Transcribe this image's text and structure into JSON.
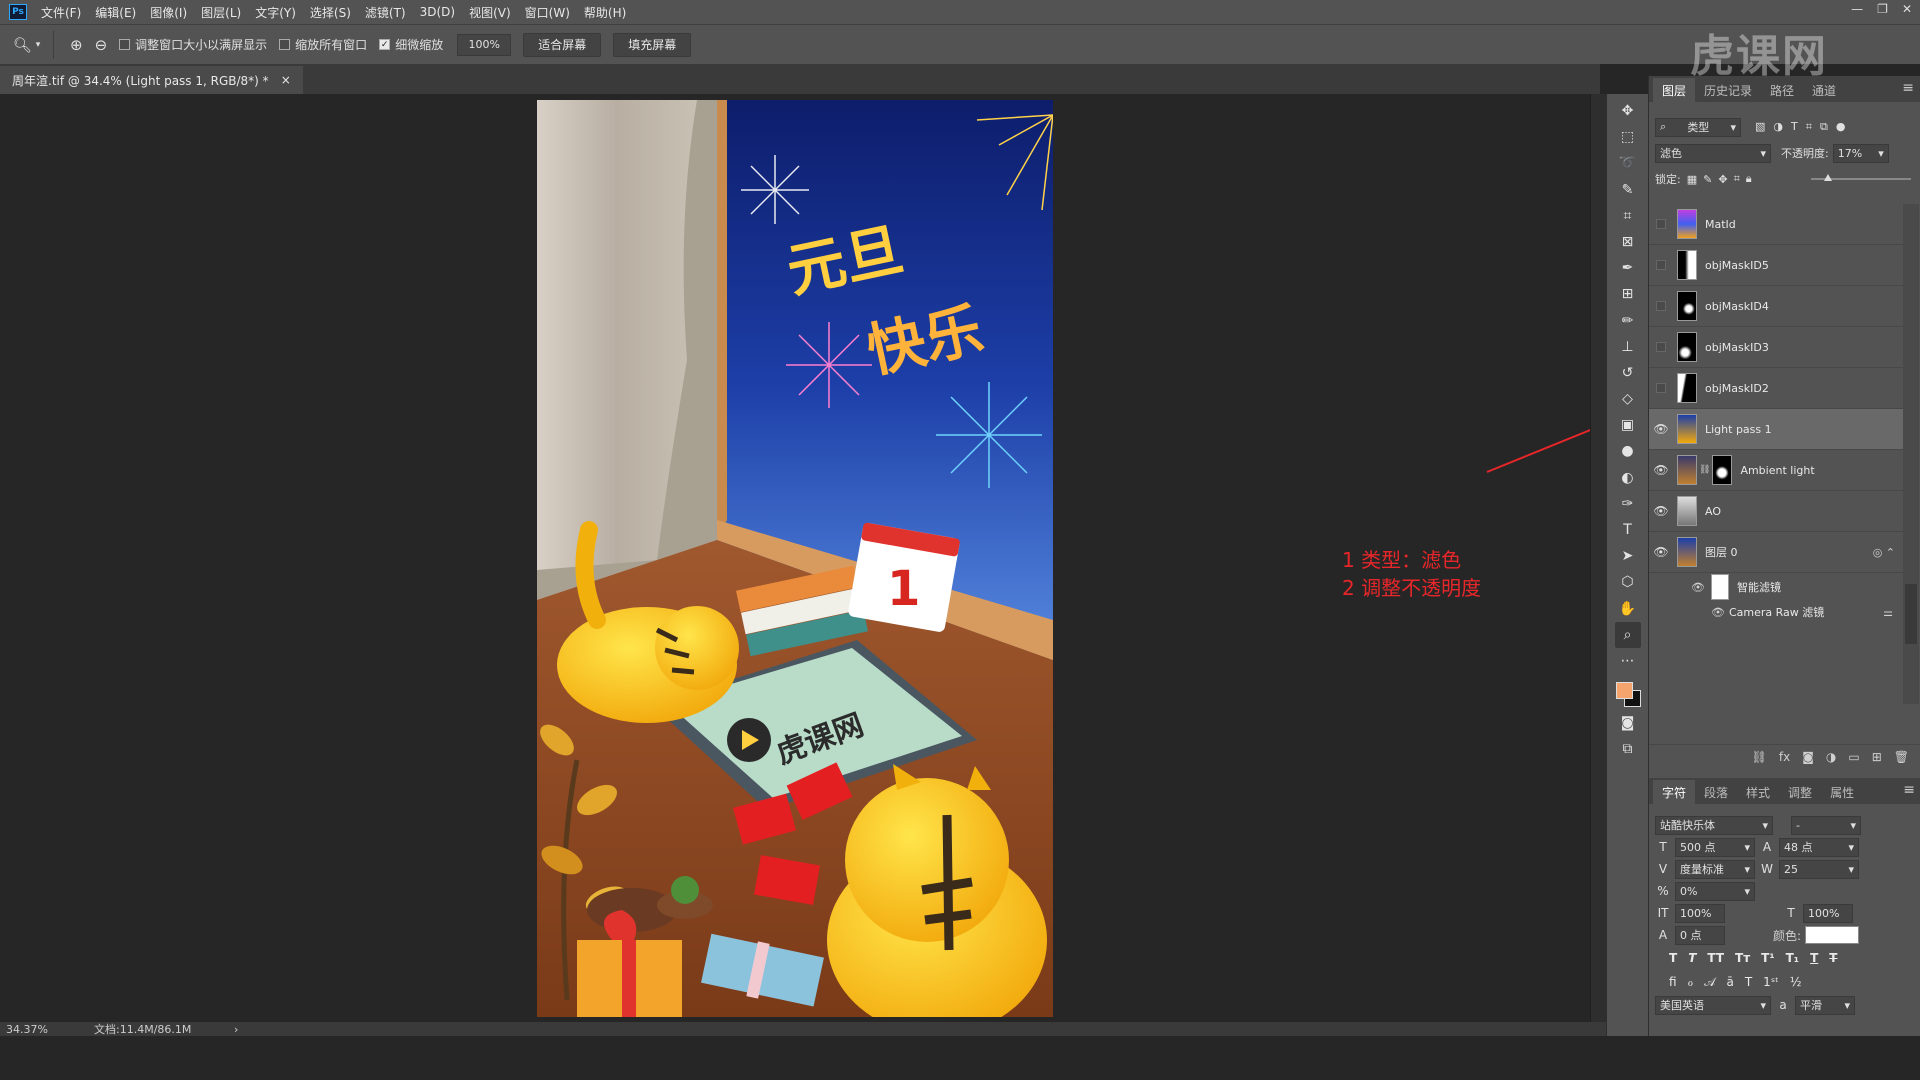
{
  "app": {
    "logo": "Ps"
  },
  "menu": [
    "文件(F)",
    "编辑(E)",
    "图像(I)",
    "图层(L)",
    "文字(Y)",
    "选择(S)",
    "滤镜(T)",
    "3D(D)",
    "视图(V)",
    "窗口(W)",
    "帮助(H)"
  ],
  "options": {
    "resize_windows": "调整窗口大小以满屏显示",
    "zoom_all": "缩放所有窗口",
    "scrubby_zoom": "细微缩放",
    "zoom_value": "100%",
    "fit_screen": "适合屏幕",
    "fill_screen": "填充屏幕"
  },
  "watermark": "虎课网",
  "document": {
    "tab_title": "周年渲.tif @ 34.4% (Light pass 1, RGB/8*) *",
    "close": "×"
  },
  "artwork": {
    "greeting_line1": "元旦",
    "greeting_line2": "快乐",
    "calendar_day": "1",
    "tablet_text": "虎课网"
  },
  "annotation": {
    "line1": "1 类型：滤色",
    "line2": "2 调整不透明度"
  },
  "status": {
    "zoom": "34.37%",
    "doc_info": "文档:11.4M/86.1M",
    "arrow": "›"
  },
  "layers_panel": {
    "tabs": [
      "图层",
      "历史记录",
      "路径",
      "通道"
    ],
    "filter_kind": "类型",
    "blend_mode": "滤色",
    "opacity_label": "不透明度:",
    "opacity_value": "17%",
    "opacity_fraction": 0.17,
    "lock_label": "锁定:",
    "layers": [
      {
        "name": "MatId",
        "visible": false
      },
      {
        "name": "objMaskID5",
        "visible": false
      },
      {
        "name": "objMaskID4",
        "visible": false
      },
      {
        "name": "objMaskID3",
        "visible": false
      },
      {
        "name": "objMaskID2",
        "visible": false
      },
      {
        "name": "Light pass 1",
        "visible": true,
        "selected": true
      },
      {
        "name": "Ambient light",
        "visible": true
      },
      {
        "name": "AO",
        "visible": true
      },
      {
        "name": "图层 0",
        "visible": true
      }
    ],
    "smart_filters": "智能滤镜",
    "camera_raw": "Camera Raw 滤镜"
  },
  "character_panel": {
    "tabs": [
      "字符",
      "段落",
      "样式",
      "调整",
      "属性"
    ],
    "font_family": "站酷快乐体",
    "font_style": "-",
    "font_size": "500 点",
    "leading": "48 点",
    "kerning": "度量标准",
    "tracking": "25",
    "tsume": "0%",
    "vertical_scale": "100%",
    "horizontal_scale": "100%",
    "baseline_shift": "0 点",
    "color_label": "颜色:",
    "language": "美国英语",
    "antialias": "平滑"
  },
  "colors": {
    "accent_red": "#e8262a",
    "foreground": "#f4a46c",
    "background": "#111111"
  }
}
